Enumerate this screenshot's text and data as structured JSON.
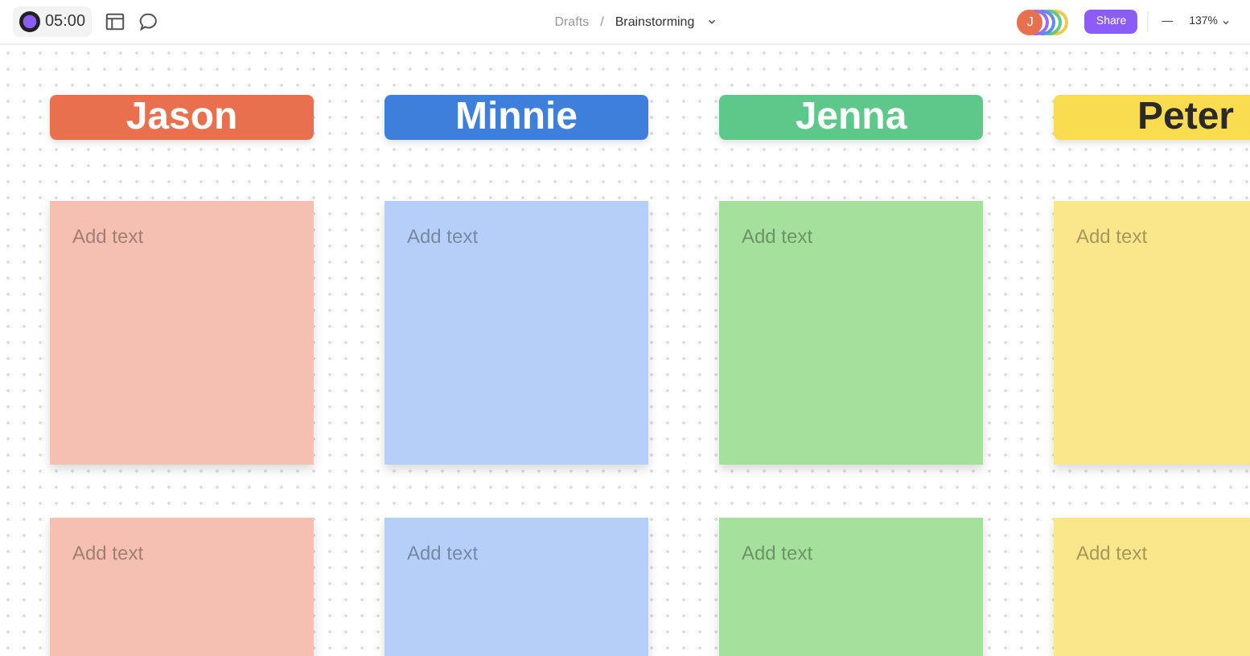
{
  "toolbar": {
    "timer": "05:00",
    "breadcrumb": {
      "parent": "Drafts",
      "separator": "/",
      "current": "Brainstorming"
    },
    "avatars": [
      {
        "initial": "J",
        "color": "#e8704f"
      },
      {
        "color": "#9b6cf0"
      },
      {
        "color": "#5b8ef0"
      },
      {
        "color": "#5ec78a"
      },
      {
        "color": "#f0c94a"
      }
    ],
    "share": "Share",
    "zoom_out": "—",
    "zoom": "137%"
  },
  "columns": [
    {
      "name": "Jason",
      "color": "#e8704f",
      "dark_text": false,
      "notes": [
        {
          "text": "Add text",
          "color": "#f5c0b1"
        },
        {
          "text": "Add text",
          "color": "#f5c0b1"
        }
      ]
    },
    {
      "name": "Minnie",
      "color": "#3f7fdc",
      "dark_text": false,
      "notes": [
        {
          "text": "Add text",
          "color": "#b6cff8"
        },
        {
          "text": "Add text",
          "color": "#b6cff8"
        }
      ]
    },
    {
      "name": "Jenna",
      "color": "#5ec78a",
      "dark_text": false,
      "notes": [
        {
          "text": "Add text",
          "color": "#a5e09c"
        },
        {
          "text": "Add text",
          "color": "#a5e09c"
        }
      ]
    },
    {
      "name": "Peter",
      "color": "#f9dc50",
      "dark_text": true,
      "notes": [
        {
          "text": "Add text",
          "color": "#fbe78b"
        },
        {
          "text": "Add text",
          "color": "#fbe78b"
        }
      ]
    }
  ]
}
